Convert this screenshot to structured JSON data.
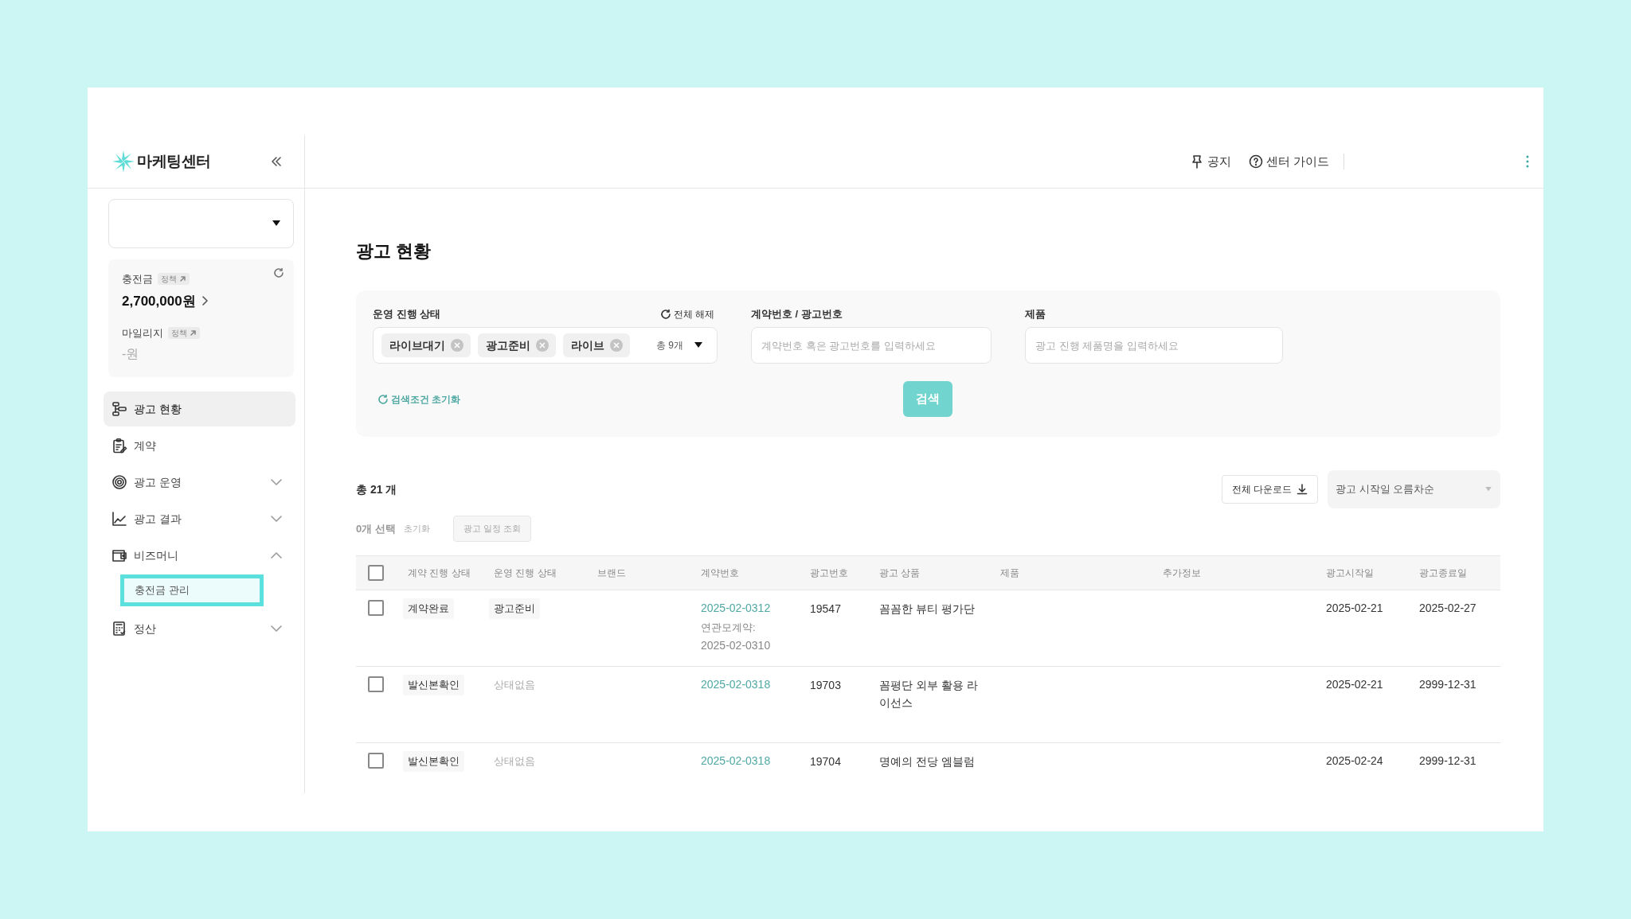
{
  "sidebar": {
    "logo": "마케팅센터",
    "balance": {
      "charge_label": "충전금",
      "charge_policy": "정책",
      "charge_amount": "2,700,000원",
      "mileage_label": "마일리지",
      "mileage_policy": "정책",
      "mileage_amount": "-원"
    },
    "nav": [
      {
        "kind": "flow",
        "label": "광고 현황",
        "selected": true
      },
      {
        "kind": "clipboard",
        "label": "계약",
        "selected": false
      },
      {
        "kind": "target",
        "label": "광고 운영",
        "selected": false,
        "expanded": false
      },
      {
        "kind": "chart",
        "label": "광고 결과",
        "selected": false,
        "expanded": false
      },
      {
        "kind": "wallet",
        "label": "비즈머니",
        "selected": false,
        "expanded": true,
        "children": [
          {
            "label": "충전금 관리",
            "highlighted": true
          }
        ]
      },
      {
        "kind": "calculator",
        "label": "정산",
        "selected": false,
        "expanded": false
      }
    ]
  },
  "header": {
    "links": [
      {
        "kind": "pin",
        "label": "공지"
      },
      {
        "kind": "help",
        "label": "센터 가이드"
      }
    ]
  },
  "page": {
    "title": "광고 현황"
  },
  "filters": {
    "status": {
      "label": "운영 진행 상태",
      "clear_all": "전체 해제",
      "chips": [
        "라이브대기",
        "광고준비",
        "라이브"
      ],
      "count": "총 9개"
    },
    "contract": {
      "label": "계약번호 / 광고번호",
      "placeholder": "계약번호 혹은 광고번호를 입력하세요"
    },
    "product": {
      "label": "제품",
      "placeholder": "광고 진행 제품명을 입력하세요"
    },
    "reset": "검색조건 초기화",
    "search_button": "검색"
  },
  "results": {
    "total": "총 21 개",
    "download": "전체 다운로드",
    "sort": "광고 시작일 오름차순",
    "selected_count": "0개 선택",
    "reset": "초기화",
    "schedule_button": {
      "label": "광고 일정 조회",
      "disabled": true
    }
  },
  "table": {
    "all_checked": false,
    "columns": [
      "계약 진행 상태",
      "운영 진행 상태",
      "브랜드",
      "계약번호",
      "광고번호",
      "광고 상품",
      "제품",
      "추가정보",
      "광고시작일",
      "광고종료일"
    ],
    "rows": [
      {
        "checked": false,
        "contract_status": "계약완료",
        "operation_status": {
          "kind": "tag",
          "label": "광고준비"
        },
        "contract_no": "2025-02-0312",
        "parent_contract_label": "연관모계약:",
        "parent_contract_no": "2025-02-0310",
        "ad_no": "19547",
        "ad_product": "꼼꼼한 뷰티 평가단",
        "start": "2025-02-21",
        "end": "2025-02-27"
      },
      {
        "checked": false,
        "contract_status": "발신본확인",
        "operation_status": {
          "kind": "plain",
          "label": "상태없음"
        },
        "contract_no": "2025-02-0318",
        "ad_no": "19703",
        "ad_product": "꼼평단 외부 활용 라이선스",
        "start": "2025-02-21",
        "end": "2999-12-31"
      },
      {
        "checked": false,
        "contract_status": "발신본확인",
        "operation_status": {
          "kind": "plain",
          "label": "상태없음"
        },
        "contract_no": "2025-02-0318",
        "ad_no": "19704",
        "ad_product": "명예의 전당 엠블럼",
        "start": "2025-02-24",
        "end": "2999-12-31"
      }
    ]
  }
}
